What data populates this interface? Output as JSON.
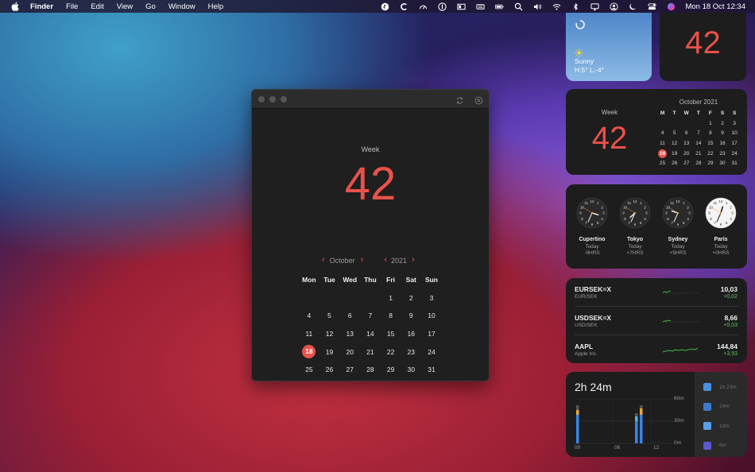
{
  "menubar": {
    "app": "Finder",
    "menus": [
      "File",
      "Edit",
      "View",
      "Go",
      "Window",
      "Help"
    ],
    "clock": "Mon 18 Oct  12:34",
    "status_icons": [
      "shazam-icon",
      "c-app-icon",
      "speedometer-icon",
      "onepassword-icon",
      "display-icon",
      "keyboard-icon",
      "battery-icon",
      "search-icon",
      "volume-icon",
      "wifi-icon",
      "bluetooth-icon",
      "screen-mirroring-icon",
      "user-icon",
      "do-not-disturb-icon",
      "control-center-icon",
      "siri-icon"
    ]
  },
  "window": {
    "week_label": "Week",
    "week_number": "42",
    "month": "October",
    "year": "2021",
    "weekdays": [
      "Mon",
      "Tue",
      "Wed",
      "Thu",
      "Fri",
      "Sat",
      "Sun"
    ],
    "weeks": [
      [
        "",
        "",
        "",
        "",
        "1",
        "2",
        "3"
      ],
      [
        "4",
        "5",
        "6",
        "7",
        "8",
        "9",
        "10"
      ],
      [
        "11",
        "12",
        "13",
        "14",
        "15",
        "16",
        "17"
      ],
      [
        "18",
        "19",
        "20",
        "21",
        "22",
        "23",
        "24"
      ],
      [
        "25",
        "26",
        "27",
        "28",
        "29",
        "30",
        "31"
      ]
    ],
    "today": "18",
    "accent": "#e8524a"
  },
  "weather": {
    "condition": "Sunny",
    "range": "H:5° L:-4°"
  },
  "week_widget_small": {
    "number": "42"
  },
  "week_widget": {
    "label": "Week",
    "number": "42",
    "title": "October 2021",
    "weekdays": [
      "M",
      "T",
      "W",
      "T",
      "F",
      "S",
      "S"
    ],
    "weeks": [
      [
        "",
        "",
        "",
        "",
        "1",
        "2",
        "3"
      ],
      [
        "4",
        "5",
        "6",
        "7",
        "8",
        "9",
        "10"
      ],
      [
        "11",
        "12",
        "13",
        "14",
        "15",
        "16",
        "17"
      ],
      [
        "18",
        "19",
        "20",
        "21",
        "22",
        "23",
        "24"
      ],
      [
        "25",
        "26",
        "27",
        "28",
        "29",
        "30",
        "31"
      ]
    ],
    "today": "18"
  },
  "world_clocks": [
    {
      "city": "Cupertino",
      "day": "Today",
      "offset": "-9HRS",
      "hour": 3,
      "minute": 34,
      "light": false
    },
    {
      "city": "Tokyo",
      "day": "Today",
      "offset": "+7HRS",
      "hour": 7,
      "minute": 34,
      "light": false
    },
    {
      "city": "Sydney",
      "day": "Today",
      "offset": "+9HRS",
      "hour": 9,
      "minute": 34,
      "light": false
    },
    {
      "city": "Paris",
      "day": "Today",
      "offset": "+0HRS",
      "hour": 12,
      "minute": 34,
      "light": true
    }
  ],
  "stocks": [
    {
      "symbol": "EURSEK=X",
      "name": "EUR/SEK",
      "price": "10,03",
      "change": "+0,02"
    },
    {
      "symbol": "USDSEK=X",
      "name": "USD/SEK",
      "price": "8,66",
      "change": "+0,03"
    },
    {
      "symbol": "AAPL",
      "name": "Apple Inc.",
      "price": "144,84",
      "change": "+3,93"
    }
  ],
  "screen_time": {
    "total": "2h 24m",
    "y_labels": [
      "60m",
      "30m",
      "0m"
    ],
    "x_labels": [
      "00",
      "06",
      "12"
    ],
    "apps": [
      {
        "icon": "xcode-icon",
        "time": "1h 23m",
        "color": "#4a8fe0"
      },
      {
        "icon": "preview-icon",
        "time": "14m",
        "color": "#3a7ac8"
      },
      {
        "icon": "safari-icon",
        "time": "10m",
        "color": "#5aa0e8"
      },
      {
        "icon": "teams-icon",
        "time": "6m",
        "color": "#5a5ad0"
      }
    ]
  }
}
